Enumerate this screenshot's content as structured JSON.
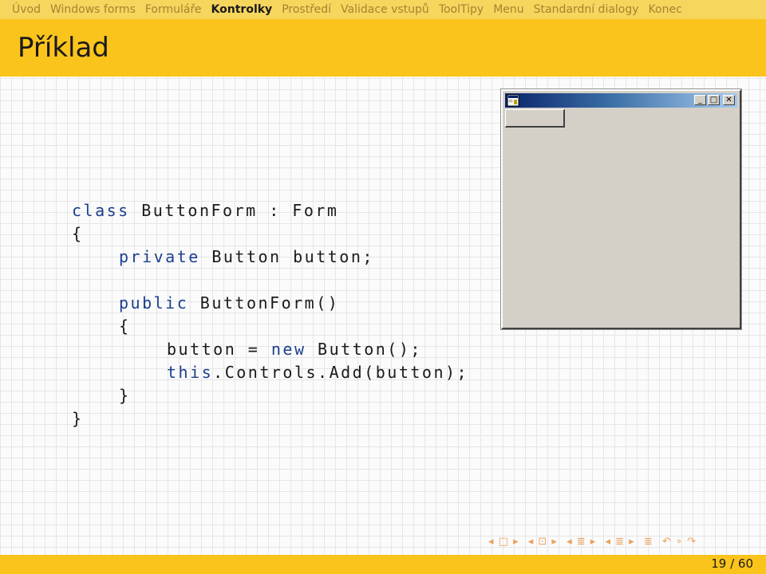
{
  "nav": {
    "items": [
      "Úvod",
      "Windows forms",
      "Formuláře",
      "Kontrolky",
      "Prostředí",
      "Validace vstupů",
      "ToolTipy",
      "Menu",
      "Standardní dialogy",
      "Konec"
    ],
    "active": "Kontrolky"
  },
  "slide": {
    "title": "Příklad"
  },
  "code": {
    "l1": {
      "k1": "class",
      "t1": " ButtonForm : Form"
    },
    "l2": "{",
    "l3": {
      "k1": "private",
      "t1": " Button button;"
    },
    "l4": {
      "k1": "public",
      "t1": " ButtonForm()"
    },
    "l5": "{",
    "l6": {
      "t1": "button = ",
      "k1": "new",
      "t2": " Button();"
    },
    "l7": {
      "k1": "this",
      "t1": ".Controls.Add(button);"
    },
    "l8": "}",
    "l9": "}"
  },
  "window": {
    "minimize_glyph": "_",
    "maximize_glyph": "□",
    "close_glyph": "✕",
    "icon": "app-window-icon"
  },
  "beamer_nav": {
    "icons": [
      "◂ □ ▸",
      "◂ ⊡ ▸",
      "◂ ≣ ▸",
      "◂ ≣ ▸",
      "≣",
      "↶ ∘ ↷"
    ]
  },
  "footer": {
    "page": "19 / 60"
  },
  "colors": {
    "accent": "#fbc41c",
    "nav_bg": "#f7d65e",
    "keyword": "#1c3f8f"
  }
}
